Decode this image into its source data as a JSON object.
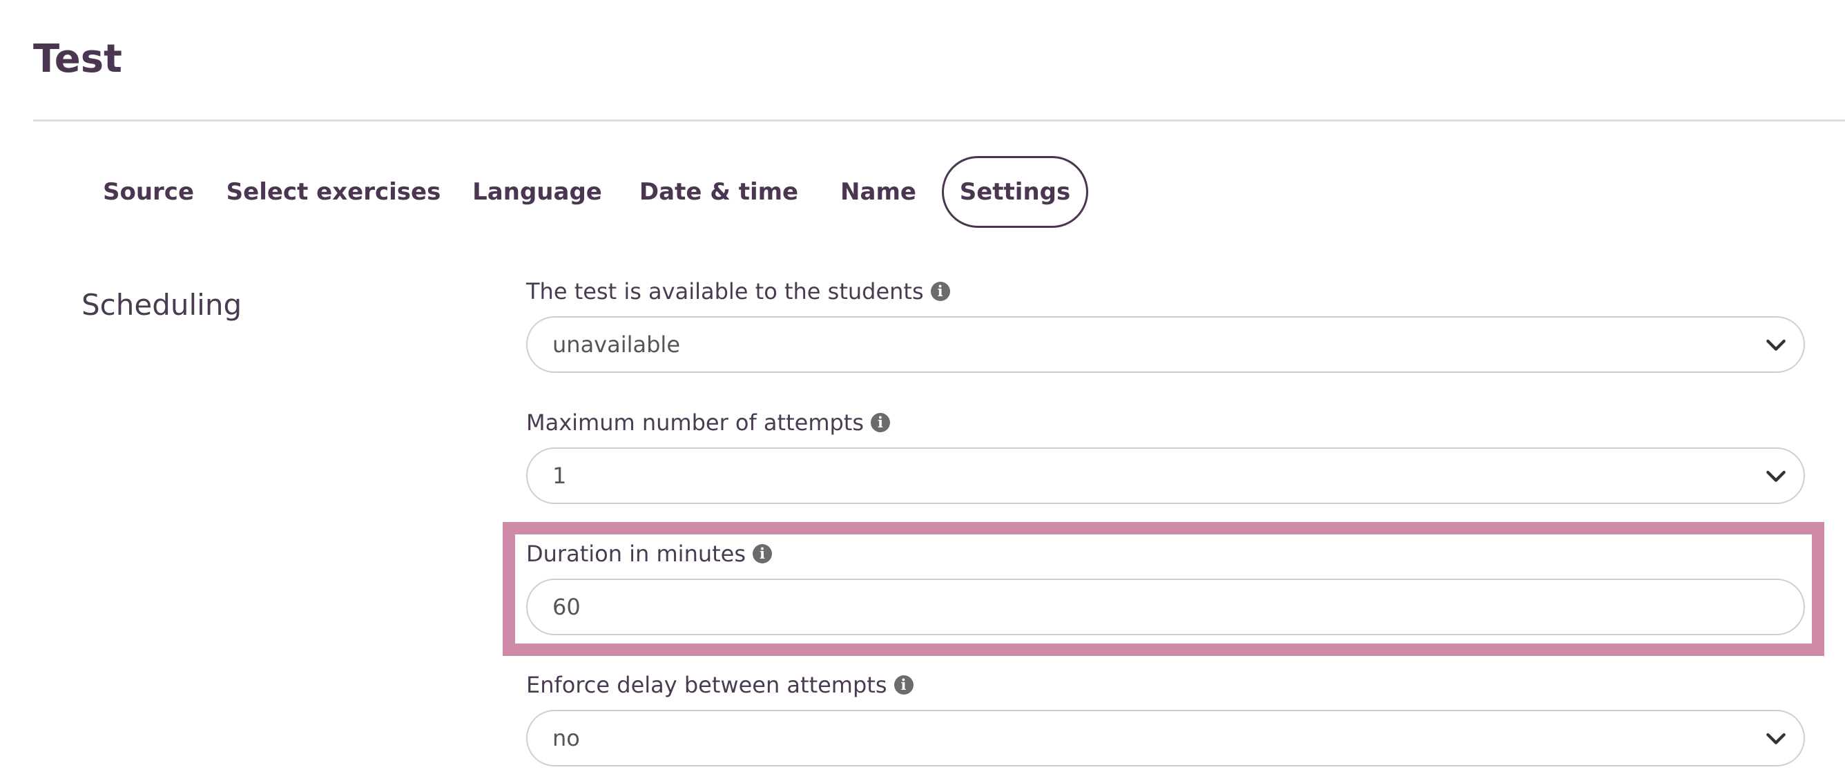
{
  "page": {
    "title": "Test"
  },
  "tabs": [
    {
      "label": "Source",
      "active": false
    },
    {
      "label": "Select exercises",
      "active": false
    },
    {
      "label": "Language",
      "active": false
    },
    {
      "label": "Date & time",
      "active": false
    },
    {
      "label": "Name",
      "active": false
    },
    {
      "label": "Settings",
      "active": true
    }
  ],
  "section": {
    "label": "Scheduling"
  },
  "fields": {
    "availability": {
      "label": "The test is available to the students",
      "value": "unavailable"
    },
    "max_attempts": {
      "label": "Maximum number of attempts",
      "value": "1"
    },
    "duration": {
      "label": "Duration in minutes",
      "value": "60"
    },
    "enforce_delay": {
      "label": "Enforce delay between attempts",
      "value": "no"
    }
  },
  "icons": {
    "info": "info-circle-icon",
    "select": "chevron-down-icon"
  },
  "colors": {
    "primary": "#4b3651",
    "highlight": "#cf8aa8",
    "border": "#cfcfcf"
  }
}
